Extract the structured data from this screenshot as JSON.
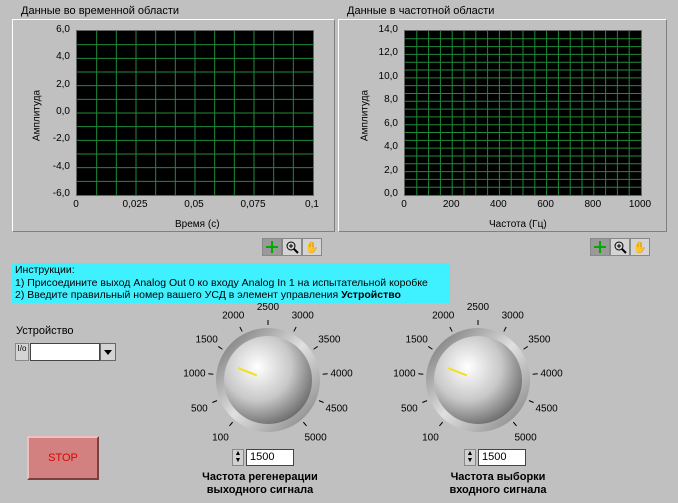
{
  "graphs": {
    "time": {
      "title": "Данные во временной области",
      "ylabel": "Амплитуда",
      "xlabel": "Время (с)",
      "yticks": [
        "6,0",
        "4,0",
        "2,0",
        "0,0",
        "-2,0",
        "-4,0",
        "-6,0"
      ],
      "xticks": [
        "0",
        "0,025",
        "0,05",
        "0,075",
        "0,1"
      ]
    },
    "freq": {
      "title": "Данные в частотной области",
      "ylabel": "Амплитуда",
      "xlabel": "Частота (Гц)",
      "yticks": [
        "14,0",
        "12,0",
        "10,0",
        "8,0",
        "6,0",
        "4,0",
        "2,0",
        "0,0"
      ],
      "xticks": [
        "0",
        "200",
        "400",
        "600",
        "800",
        "1000"
      ]
    }
  },
  "graph_tools": [
    "cursor-tool-icon",
    "zoom-tool-icon",
    "pan-hand-icon"
  ],
  "instructions": {
    "heading": "Инструкции:",
    "line1": "1) Присоедините выход Analog Out 0 ко входу Analog In 1 на испытательной коробке",
    "line2_prefix": "2) Введите правильный номер вашего УСД в элемент управления ",
    "line2_bold": "Устройство"
  },
  "device": {
    "label": "Устройство",
    "io_glyph": "I/o",
    "value": ""
  },
  "knobs": {
    "scale": [
      "100",
      "500",
      "1000",
      "1500",
      "2000",
      "2500",
      "3000",
      "3500",
      "4000",
      "4500",
      "5000"
    ],
    "regen": {
      "value": "1500",
      "caption_line1": "Частота регенерации",
      "caption_line2": "выходного сигнала"
    },
    "sample": {
      "value": "1500",
      "caption_line1": "Частота выборки",
      "caption_line2": "входного сигнала"
    }
  },
  "stop": {
    "label": "STOP"
  },
  "colors": {
    "plot_bg": "#000000",
    "grid": "#1f8a3a",
    "instructions_bg": "#3ff0ff",
    "stop_bg": "#d28080",
    "stop_text": "#e00000",
    "knob_pointer": "#f0e020"
  }
}
